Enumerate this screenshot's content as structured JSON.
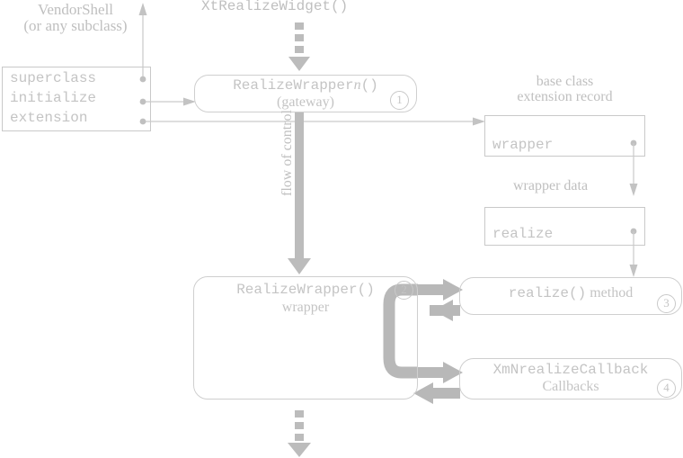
{
  "diagram": {
    "title_caption": "XtRealizeWidget()",
    "vendor_caption_line1": "VendorShell",
    "vendor_caption_line2": "(or any subclass)",
    "flow_label": "flow of control",
    "base_class_caption_line1": "base class",
    "base_class_caption_line2": "extension record",
    "wrapper_data_caption": "wrapper data",
    "colors": {
      "line": "#c9c9c9",
      "text": "#c4c4c4",
      "caption": "#bfbfbf",
      "thick_arrow": "#b8b8b8",
      "background": "#ffffff"
    },
    "struct": {
      "rows": [
        {
          "label": "superclass"
        },
        {
          "label": "initialize"
        },
        {
          "label": "extension"
        }
      ]
    },
    "boxes": [
      {
        "id": "gateway",
        "line1_prefix": "RealizeWrapper",
        "line1_italic": "n",
        "line1_suffix": "()",
        "line2": "(gateway)",
        "number": "1"
      },
      {
        "id": "wrapper_fn",
        "line1": "RealizeWrapper()",
        "line2": "wrapper",
        "number": "2"
      },
      {
        "id": "realize_method",
        "line1_mono": "realize()",
        "line1_serif": "method",
        "number": "3"
      },
      {
        "id": "callbacks",
        "line1": "XmNrealizeCallback",
        "line2": "Callbacks",
        "number": "4"
      }
    ],
    "records": [
      {
        "id": "wrapper_record",
        "label": "wrapper"
      },
      {
        "id": "realize_record",
        "label": "realize"
      }
    ]
  }
}
